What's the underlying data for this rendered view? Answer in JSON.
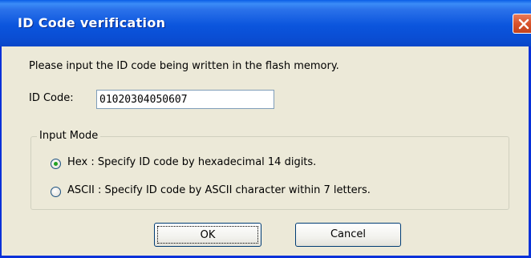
{
  "window": {
    "title": "ID Code verification",
    "close_icon": "close-x-icon"
  },
  "dialog": {
    "prompt": "Please input the ID code being written in the flash memory.",
    "id_code_label": "ID Code:",
    "id_code_value": "01020304050607"
  },
  "input_mode": {
    "legend": "Input Mode",
    "options": [
      {
        "label": "Hex : Specify ID code by hexadecimal 14 digits.",
        "selected": true
      },
      {
        "label": "ASCII  : Specify ID code by ASCII character within 7 letters.",
        "selected": false
      }
    ]
  },
  "buttons": {
    "ok_label": "OK",
    "cancel_label": "Cancel"
  },
  "colors": {
    "titlebar": "#0a55dd",
    "close": "#d8532c",
    "face": "#ece9d8",
    "radio_dot": "#21a121"
  }
}
